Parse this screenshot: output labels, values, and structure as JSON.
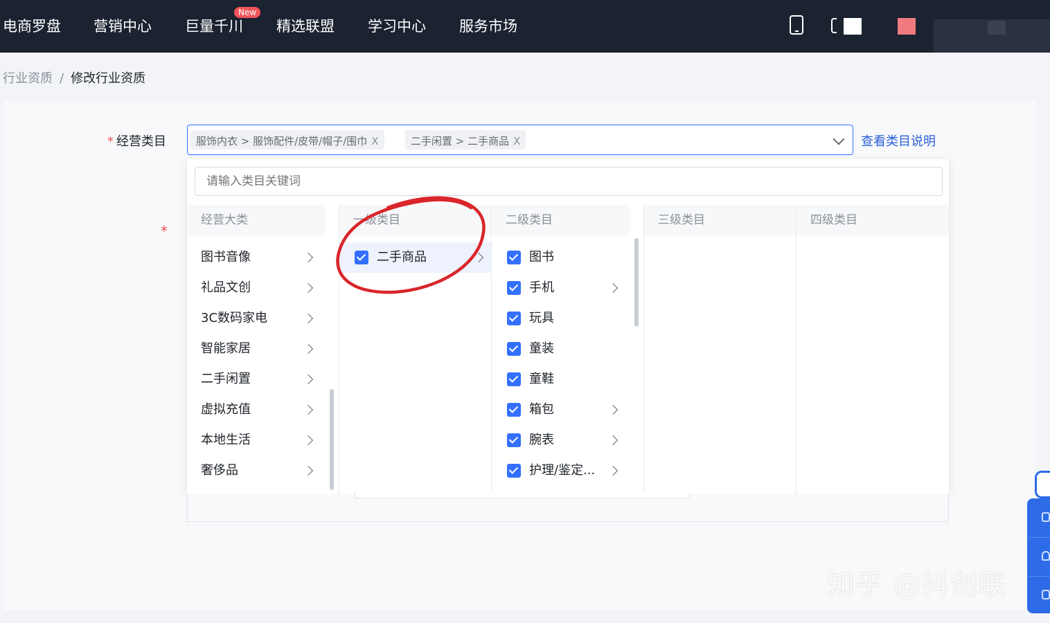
{
  "nav": {
    "items": [
      "电商罗盘",
      "营销中心",
      "巨量千川",
      "精选联盟",
      "学习中心",
      "服务市场"
    ],
    "badge": "New"
  },
  "breadcrumb": {
    "parent": "行业资质",
    "separator": "/",
    "current": "修改行业资质"
  },
  "form": {
    "required_mark": "*",
    "category_label": "经营类目",
    "tags": [
      {
        "text": "服饰内衣 > 服饰配件/皮带/帽子/围巾",
        "close": "X"
      },
      {
        "text": "二手闲置 > 二手商品",
        "close": "X"
      }
    ],
    "view_link": "查看类目说明"
  },
  "dropdown": {
    "search_placeholder": "请输入类目关键词",
    "columns": [
      "经营大类",
      "一级类目",
      "二级类目",
      "三级类目",
      "四级类目"
    ],
    "major_categories": [
      "图书音像",
      "礼品文创",
      "3C数码家电",
      "智能家居",
      "二手闲置",
      "虚拟充值",
      "本地生活",
      "奢侈品"
    ],
    "level1": [
      {
        "label": "二手商品",
        "checked": true
      }
    ],
    "level2": [
      {
        "label": "图书",
        "checked": true,
        "has_children": false
      },
      {
        "label": "手机",
        "checked": true,
        "has_children": true
      },
      {
        "label": "玩具",
        "checked": true,
        "has_children": false
      },
      {
        "label": "童装",
        "checked": true,
        "has_children": false
      },
      {
        "label": "童鞋",
        "checked": true,
        "has_children": false
      },
      {
        "label": "箱包",
        "checked": true,
        "has_children": true
      },
      {
        "label": "腕表",
        "checked": true,
        "has_children": true
      },
      {
        "label": "护理/鉴定...",
        "checked": true,
        "has_children": true
      }
    ]
  },
  "watermark": "知乎 @抖创联",
  "colors": {
    "nav_bg": "#1b2230",
    "primary": "#3370ff",
    "link": "#2b5fd9",
    "required": "#f0545a",
    "annotation": "#d9262b"
  }
}
